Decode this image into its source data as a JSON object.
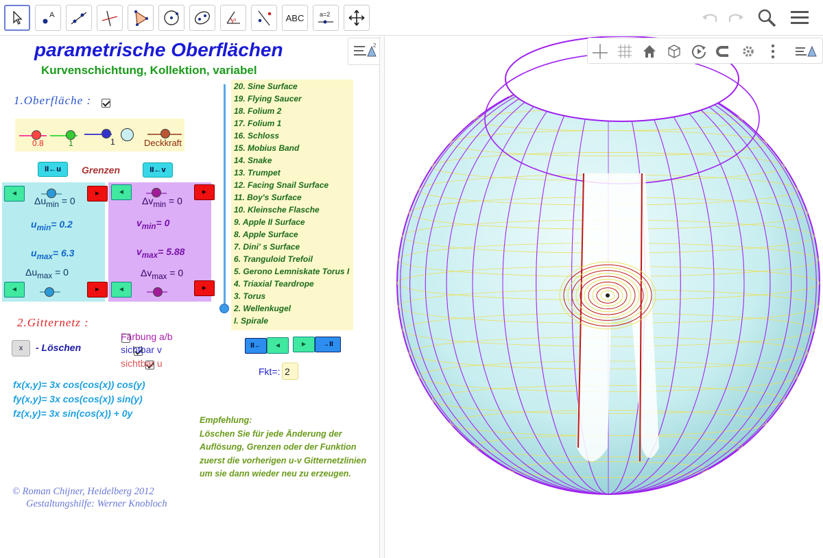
{
  "toolbar": {
    "tools": [
      {
        "name": "move-tool",
        "label": ""
      },
      {
        "name": "point-tool",
        "label": "A"
      },
      {
        "name": "line-tool",
        "label": ""
      },
      {
        "name": "perpendicular-tool",
        "label": ""
      },
      {
        "name": "polygon-tool",
        "label": ""
      },
      {
        "name": "circle-tool",
        "label": ""
      },
      {
        "name": "conic-tool",
        "label": ""
      },
      {
        "name": "angle-tool",
        "label": ""
      },
      {
        "name": "reflect-tool",
        "label": ""
      },
      {
        "name": "text-tool",
        "label": "ABC"
      },
      {
        "name": "slider-tool",
        "label": "a=2"
      },
      {
        "name": "move-graphics-tool",
        "label": ""
      }
    ]
  },
  "header": {
    "title": "parametrische Oberflächen",
    "subtitle": "Kurvenschichtung, Kollektion, variabel"
  },
  "section1": {
    "title": "1.Oberfläche :",
    "color_sliders": {
      "red_value": "0.8",
      "green_value": "1",
      "blue_value": "1",
      "opacity_label": "Deckkraft"
    }
  },
  "limits": {
    "title": "Grenzen",
    "reset_u": "II←u",
    "reset_v": "II←v",
    "delta_u_min": "Δu",
    "delta_u_min_sub": "min",
    "delta_u_min_val": "= 0",
    "u_min": "u",
    "u_min_sub": "min",
    "u_min_val": "= 0.2",
    "u_max": "u",
    "u_max_sub": "max",
    "u_max_val": "= 6.3",
    "delta_u_max": "Δu",
    "delta_u_max_sub": "max",
    "delta_u_max_val": "= 0",
    "delta_v_min": "Δv",
    "delta_v_min_sub": "min",
    "delta_v_min_val": "= 0",
    "v_min": "v",
    "v_min_sub": "min",
    "v_min_val": "= 0",
    "v_max": "v",
    "v_max_sub": "max",
    "v_max_val": "= 5.88",
    "delta_v_max": "Δv",
    "delta_v_max_sub": "max",
    "delta_v_max_val": "= 0",
    "btn_left": "◄",
    "btn_right": "►"
  },
  "surface_list": [
    "20. Sine Surface",
    "19. Flying Saucer",
    "18. Folium 2",
    "17. Folium 1",
    "16. Schloss",
    "15. Mobius Band",
    "14. Snake",
    "13. Trumpet",
    "12. Facing Snail Surface",
    "11. Boy's Surface",
    "10. Kleinsche Flasche",
    " 9. Apple II Surface",
    " 8. Apple Surface",
    " 7. Dini' s Surface",
    " 6. Tranguloid Trefoil",
    " 5. Gerono Lemniskate Torus I",
    " 4. Triaxial Teardrope",
    " 3. Torus",
    " 2. Wellenkugel",
    "  I. Spirale"
  ],
  "nav": {
    "first": "II←",
    "prev": "◄",
    "next": "►",
    "last": "→II",
    "fkt_label": "Fkt=:",
    "fkt_value": "2"
  },
  "section2": {
    "title": "2.Gitternetz :",
    "delete_button": "x",
    "delete_label": "- Löschen",
    "coloring_label": "Färbung a/b",
    "visible_v_label": "sichtbar v",
    "visible_u_label": "sichtbar u",
    "coloring_checked": false,
    "visible_v_checked": true,
    "visible_u_checked": true
  },
  "functions": {
    "fx": "fx(x,y)= 3x cos(cos(x)) cos(y)",
    "fy": "fy(x,y)= 3x cos(cos(x)) sin(y)",
    "fz": "fz(x,y)= 3x sin(cos(x)) + 0y"
  },
  "recommendation": [
    "Empfehlung:",
    "Löschen Sie für jede Änderung der",
    "Auflösung, Grenzen oder der Funktion",
    "zuerst die vorherigen u-v Gitternetzlinien",
    "um sie dann wieder neu zu erzeugen."
  ],
  "credits": {
    "line1": "© Roman Chijner, Heidelberg 2012",
    "line2": "Gestaltungshilfe: Werner Knobloch"
  },
  "colors": {
    "title_blue": "#1a1ad6",
    "subtitle_green": "#1a9a1a",
    "surface_fill": "#c8eef0",
    "grid_purple": "#a020f0",
    "grid_red": "#c01818",
    "grid_yellow": "#e8e060"
  },
  "graphics_toolbar": {
    "icons": [
      "axes-icon",
      "grid-icon",
      "home-icon",
      "cube-icon",
      "rotate-icon",
      "projection-icon",
      "settings-icon",
      "more-icon",
      "style-bar-icon"
    ]
  }
}
